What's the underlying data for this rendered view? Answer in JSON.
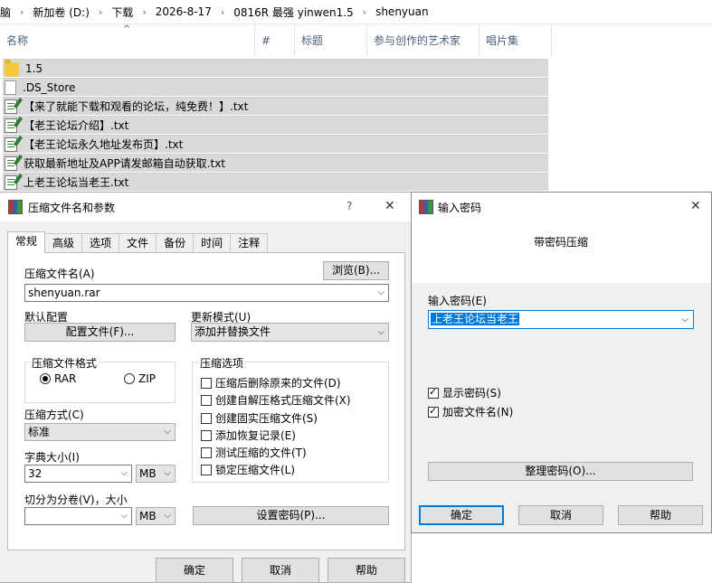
{
  "explorer": {
    "breadcrumb": [
      "脑",
      "新加卷 (D:)",
      "下载",
      "2026-8-17",
      "0816R 最强 yinwen1.5",
      "shenyuan"
    ],
    "columns": [
      "名称",
      "#",
      "标题",
      "参与创作的艺术家",
      "唱片集"
    ],
    "files": [
      {
        "name": "1.5",
        "icon": "folder-icon"
      },
      {
        "name": ".DS_Store",
        "icon": "file-icon"
      },
      {
        "name": "【来了就能下载和观看的论坛，纯免费！】.txt",
        "icon": "text-file-icon"
      },
      {
        "name": "【老王论坛介绍】.txt",
        "icon": "text-file-icon"
      },
      {
        "name": "【老王论坛永久地址发布页】.txt",
        "icon": "text-file-icon"
      },
      {
        "name": "获取最新地址及APP请发邮箱自动获取.txt",
        "icon": "text-file-icon"
      },
      {
        "name": "上老王论坛当老王.txt",
        "icon": "text-file-icon"
      }
    ]
  },
  "archive_dialog": {
    "title": "压缩文件名和参数",
    "help": "?",
    "close": "✕",
    "tabs": [
      "常规",
      "高级",
      "选项",
      "文件",
      "备份",
      "时间",
      "注释"
    ],
    "archive_name_label": "压缩文件名(A)",
    "browse_button": "浏览(B)...",
    "archive_name_value": "shenyuan.rar",
    "default_profile_label": "默认配置",
    "profiles_button": "配置文件(F)...",
    "update_mode_label": "更新模式(U)",
    "update_mode_value": "添加并替换文件",
    "format_label": "压缩文件格式",
    "format_rar": "RAR",
    "format_zip": "ZIP",
    "method_label": "压缩方式(C)",
    "method_value": "标准",
    "dict_label": "字典大小(I)",
    "dict_value": "32",
    "dict_unit": "MB",
    "split_label": "切分为分卷(V)，大小",
    "split_value": "",
    "split_unit": "MB",
    "options_label": "压缩选项",
    "options": [
      {
        "label": "压缩后删除原来的文件(D)",
        "checked": false
      },
      {
        "label": "创建自解压格式压缩文件(X)",
        "checked": false
      },
      {
        "label": "创建固实压缩文件(S)",
        "checked": false
      },
      {
        "label": "添加恢复记录(E)",
        "checked": false
      },
      {
        "label": "测试压缩的文件(T)",
        "checked": false
      },
      {
        "label": "锁定压缩文件(L)",
        "checked": false
      }
    ],
    "set_password_button": "设置密码(P)...",
    "ok_button": "确定",
    "cancel_button": "取消",
    "help_button": "帮助"
  },
  "password_dialog": {
    "title": "输入密码",
    "close": "✕",
    "heading": "带密码压缩",
    "password_label": "输入密码(E)",
    "password_value": "上老王论坛当老王",
    "show_password": "显示密码(S)",
    "encrypt_names": "加密文件名(N)",
    "organize_button": "整理密码(O)...",
    "ok_button": "确定",
    "cancel_button": "取消",
    "help_button": "帮助"
  }
}
